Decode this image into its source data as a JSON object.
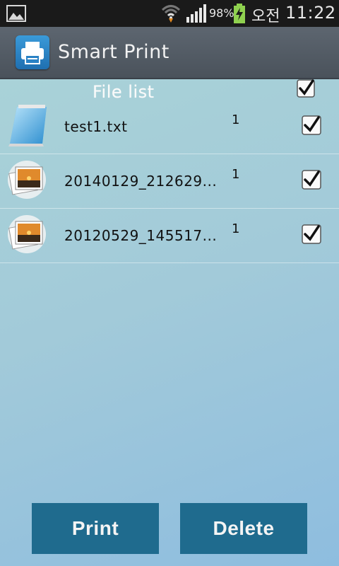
{
  "status_bar": {
    "battery_percent": "98%",
    "ampm": "오전",
    "time": "11:22",
    "icons": [
      "gallery-notification-icon",
      "wifi-icon",
      "signal-icon",
      "battery-charging-icon"
    ]
  },
  "app": {
    "title": "Smart Print",
    "icon": "printer-icon"
  },
  "list": {
    "header": "File list",
    "select_all_checked": true,
    "items": [
      {
        "name": "test1.txt",
        "copies": "1",
        "checked": true,
        "type": "text",
        "icon": "text-file-icon"
      },
      {
        "name": "20140129_212629...",
        "copies": "1",
        "checked": true,
        "type": "image",
        "icon": "image-file-icon"
      },
      {
        "name": "20120529_145517...",
        "copies": "1",
        "checked": true,
        "type": "image",
        "icon": "image-file-icon"
      }
    ]
  },
  "buttons": {
    "print": "Print",
    "delete": "Delete"
  },
  "colors": {
    "title_bar": "#535b64",
    "button": "#1f6b8e",
    "background_top": "#a9d2d8",
    "background_bottom": "#8ebddf"
  }
}
